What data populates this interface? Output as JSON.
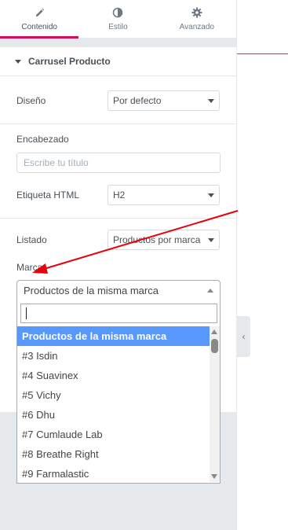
{
  "tabs": [
    {
      "label": "Contenido",
      "icon": "pencil-icon",
      "active": true
    },
    {
      "label": "Estilo",
      "icon": "half-circle-icon",
      "active": false
    },
    {
      "label": "Avanzado",
      "icon": "gear-icon",
      "active": false
    }
  ],
  "section": {
    "title": "Carrusel Producto",
    "diseno_label": "Diseño",
    "diseno_value": "Por defecto",
    "encabezado_label": "Encabezado",
    "encabezado_placeholder": "Escribe tu título",
    "etiqueta_label": "Etiqueta HTML",
    "etiqueta_value": "H2",
    "listado_label": "Listado",
    "listado_value": "Productos por marca",
    "marca_label": "Marca",
    "marca_value": "Productos de la misma marca"
  },
  "dropdown": {
    "search_value": "",
    "options": [
      "Productos de la misma marca",
      "#3 Isdin",
      "#4 Suavinex",
      "#5 Vichy",
      "#6 Dhu",
      "#7 Cumlaude Lab",
      "#8 Breathe Right",
      "#9 Farmalastic"
    ],
    "highlighted_index": 0
  },
  "colors": {
    "accent": "#d30c5c",
    "highlight": "#5897fb",
    "annotation_arrow": "#e8000b"
  }
}
